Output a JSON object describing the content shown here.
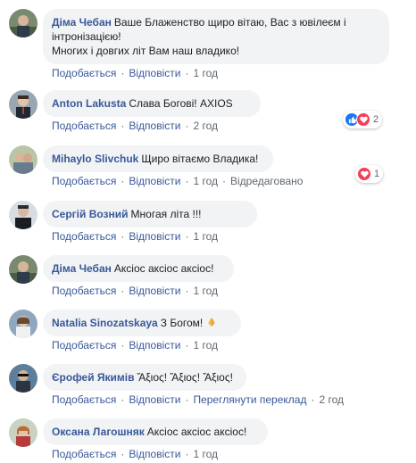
{
  "colors": {
    "link": "#385898",
    "bubble_bg": "#f2f3f5",
    "meta_text": "#606770",
    "like": "#1877f2",
    "love": "#f33e58"
  },
  "comments": [
    {
      "author": "Діма Чебан",
      "text": "Ваше Блаженство щиро вітаю, Вас з ювілеєм і\nінтронізацією!\nМногих і довгих літ Вам наш владико!",
      "like_label": "Подобається",
      "reply_label": "Відповісти",
      "time": "1 год"
    },
    {
      "author": "Anton Lakusta",
      "text": "Слава Богові! AXIOS",
      "like_label": "Подобається",
      "reply_label": "Відповісти",
      "time": "2 год",
      "reactions": {
        "icons": [
          "like-icon",
          "love-icon"
        ],
        "count": "2"
      }
    },
    {
      "author": "Mihaylo Slivchuk",
      "text": "Щиро вітаємо Владика!",
      "like_label": "Подобається",
      "reply_label": "Відповісти",
      "time": "1 год",
      "edited": "Відредаговано",
      "reactions": {
        "icons": [
          "love-icon"
        ],
        "count": "1"
      }
    },
    {
      "author": "Сергій Возний",
      "text": "Многая літа !!!",
      "like_label": "Подобається",
      "reply_label": "Відповісти",
      "time": "1 год"
    },
    {
      "author": "Діма Чебан",
      "text": "Аксіос аксіос аксіос!",
      "like_label": "Подобається",
      "reply_label": "Відповісти",
      "time": "1 год"
    },
    {
      "author": "Natalia Sinozatskaya",
      "text": "З Богом!",
      "emoji": "praying-hands-emoji",
      "like_label": "Подобається",
      "reply_label": "Відповісти",
      "time": "1 год"
    },
    {
      "author": "Єрофей Якимів",
      "text": "Ἄξιος! Ἄξιος! Ἄξιος!",
      "like_label": "Подобається",
      "reply_label": "Відповісти",
      "translate_label": "Переглянути переклад",
      "time": "2 год"
    },
    {
      "author": "Оксана Лагошняк",
      "text": "Аксіос аксіос аксіос!",
      "like_label": "Подобається",
      "reply_label": "Відповісти",
      "time": "1 год"
    }
  ]
}
